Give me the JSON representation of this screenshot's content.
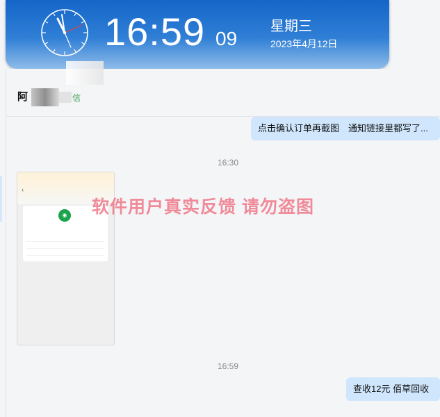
{
  "clock": {
    "time": "16:59",
    "seconds": "09",
    "weekday": "星期三",
    "date": "2023年4月12日"
  },
  "header": {
    "contact_name": "阿",
    "contact_tag": "信"
  },
  "messages": [
    {
      "text": "点击确认订单再截图　通知链接里都写了..."
    },
    {
      "timestamp": "16:30"
    },
    {
      "timestamp": "16:59"
    },
    {
      "text": "查收12元  佰草回收"
    }
  ],
  "watermark": "软件用户真实反馈  请勿盗图",
  "colors": {
    "banner": "#1565c9",
    "bubble": "#cfe6fc",
    "watermark": "#ee5c70"
  }
}
